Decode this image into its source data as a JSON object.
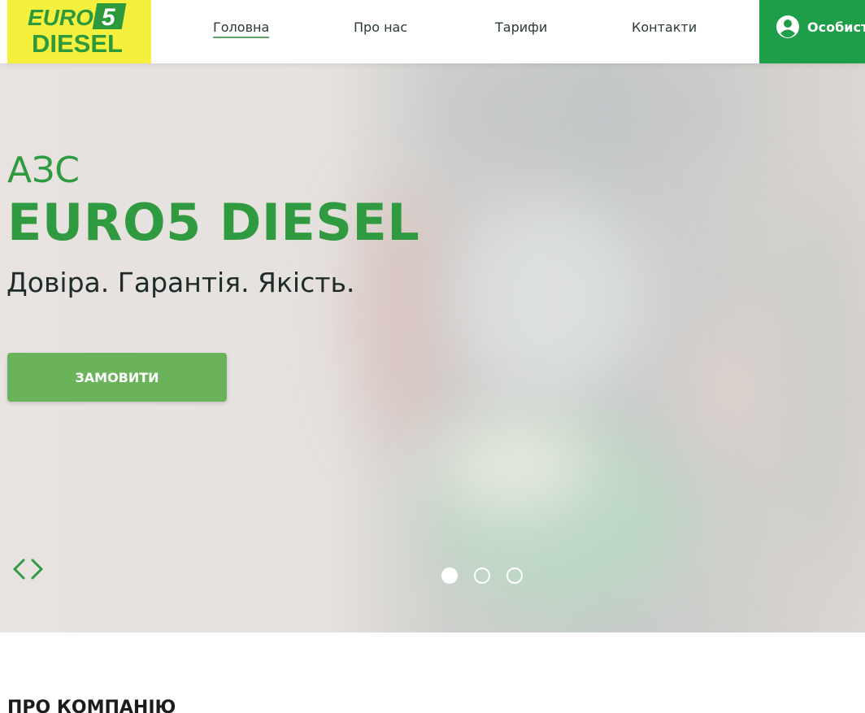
{
  "header": {
    "logo": {
      "line1": "EURO",
      "digit": "5",
      "line2": "DIESEL"
    },
    "nav": [
      {
        "label": "Головна",
        "active": true
      },
      {
        "label": "Про нас",
        "active": false
      },
      {
        "label": "Тарифи",
        "active": false
      },
      {
        "label": "Контакти",
        "active": false
      }
    ],
    "account_label": "Особистий кабінет"
  },
  "hero": {
    "title_small": "АЗС",
    "title_big": "EURO5 DIESEL",
    "slogan": "Довіра. Гарантія. Якість.",
    "cta_label": "ЗАМОВИТИ",
    "slides": {
      "count": 3,
      "active_index": 0
    }
  },
  "about": {
    "title": "ПРО КОМПАНІЮ"
  },
  "colors": {
    "brand_green": "#2f9a3f",
    "account_green": "#1f9e49",
    "cta_green": "#6bb35a",
    "logo_yellow": "#f5ef3d"
  },
  "icons": [
    "user-circle-icon",
    "chevron-left-icon",
    "chevron-right-icon"
  ]
}
